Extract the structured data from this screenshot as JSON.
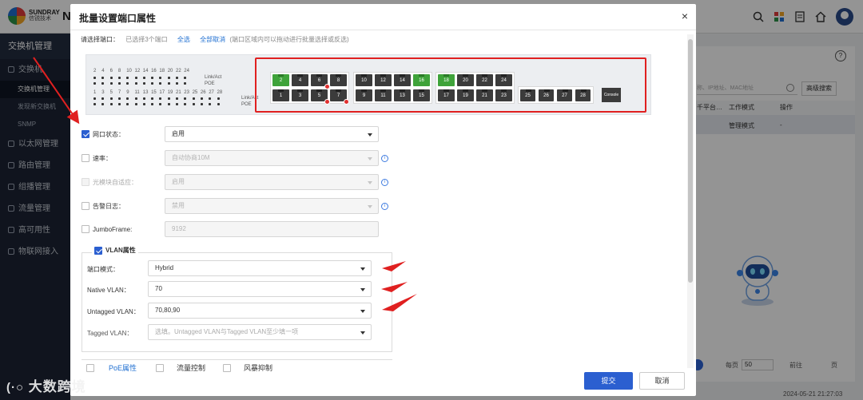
{
  "app": {
    "logo_line1": "SUNDRAY",
    "logo_line2": "信锐技术",
    "logo_suffix": "N",
    "sidebar_header": "交换机管理",
    "sidebar": [
      {
        "label": "交换机",
        "type": "item",
        "icon": "switch-icon"
      },
      {
        "label": "交换机管理",
        "type": "sub",
        "active": true
      },
      {
        "label": "发现新交换机",
        "type": "sub",
        "active": false
      },
      {
        "label": "SNMP",
        "type": "sub",
        "active": false
      },
      {
        "label": "以太网管理",
        "type": "item",
        "icon": "ethernet-icon"
      },
      {
        "label": "路由管理",
        "type": "item",
        "icon": "route-icon"
      },
      {
        "label": "组播管理",
        "type": "item",
        "icon": "multicast-icon"
      },
      {
        "label": "流量管理",
        "type": "item",
        "icon": "traffic-icon"
      },
      {
        "label": "高可用性",
        "type": "item",
        "icon": "ha-icon"
      },
      {
        "label": "物联网接入",
        "type": "item",
        "icon": "iot-icon"
      }
    ],
    "bg": {
      "search_placeholder": "称、IP地址、MAC地址",
      "advanced_search": "高级搜索",
      "col_platform": "千平台…",
      "col_mode": "工作模式",
      "col_ops": "操作",
      "row_mode": "管理模式",
      "row_ops": "-",
      "pager_label": "每页",
      "pager_size": "50",
      "pager_goto": "前往",
      "pager_page": "页",
      "timestamp": "2024-05-21 21:27:03"
    }
  },
  "dialog": {
    "title": "批量设置端口属性",
    "close": "×",
    "select_label": "请选择端口：",
    "select_count": "已选择3个端口",
    "select_all": "全选",
    "deselect_all": "全部取消",
    "select_hint": "(端口区域内可以拖动进行批量选择或反选)",
    "panel": {
      "top_numbers": [
        "2",
        "4",
        "6",
        "8",
        "10",
        "12",
        "14",
        "16",
        "18",
        "20",
        "22",
        "24"
      ],
      "bottom_numbers": [
        "1",
        "3",
        "5",
        "7",
        "9",
        "11",
        "13",
        "15",
        "17",
        "19",
        "21",
        "23",
        "25",
        "26",
        "27",
        "28"
      ],
      "label_link": "Link/Act",
      "label_poe": "POE",
      "groups": [
        {
          "top": [
            {
              "n": "2",
              "up": true
            },
            {
              "n": "4",
              "up": false
            },
            {
              "n": "6",
              "up": false,
              "err": true
            },
            {
              "n": "8",
              "up": false
            }
          ],
          "bottom": [
            {
              "n": "1",
              "up": false
            },
            {
              "n": "3",
              "up": false
            },
            {
              "n": "5",
              "up": false,
              "err": true
            },
            {
              "n": "7",
              "up": false,
              "err": true
            }
          ]
        },
        {
          "top": [
            {
              "n": "10",
              "up": false
            },
            {
              "n": "12",
              "up": false
            },
            {
              "n": "14",
              "up": false
            },
            {
              "n": "16",
              "up": true
            }
          ],
          "bottom": [
            {
              "n": "9",
              "up": false
            },
            {
              "n": "11",
              "up": false
            },
            {
              "n": "13",
              "up": false
            },
            {
              "n": "15",
              "up": false
            }
          ]
        },
        {
          "top": [
            {
              "n": "18",
              "up": true
            },
            {
              "n": "20",
              "up": false
            },
            {
              "n": "22",
              "up": false
            },
            {
              "n": "24",
              "up": false
            }
          ],
          "bottom": [
            {
              "n": "17",
              "up": false
            },
            {
              "n": "19",
              "up": false
            },
            {
              "n": "21",
              "up": false
            },
            {
              "n": "23",
              "up": false
            }
          ]
        }
      ],
      "sfp_ports": [
        "25",
        "26",
        "27",
        "28"
      ],
      "console_label": "Console"
    },
    "fields": {
      "port_status": {
        "label": "网口状态：",
        "checked": true,
        "value": "启用"
      },
      "speed": {
        "label": "速率：",
        "checked": false,
        "value": "自动协商10M"
      },
      "optical": {
        "label": "光模块自适应：",
        "checked": false,
        "value": "启用"
      },
      "alarm_log": {
        "label": "告警日志：",
        "checked": false,
        "value": "禁用"
      },
      "jumbo": {
        "label": "JumboFrame:",
        "checked": false,
        "value": "9192"
      }
    },
    "vlan": {
      "title": "VLAN属性",
      "checked": true,
      "port_mode_label": "端口模式：",
      "port_mode_value": "Hybrid",
      "native_label": "Native VLAN：",
      "native_value": "70",
      "untagged_label": "Untagged VLAN：",
      "untagged_value": "70,80,90",
      "tagged_label": "Tagged VLAN：",
      "tagged_placeholder": "选填。Untagged VLAN与Tagged VLAN至少填一项"
    },
    "bottom_tabs": [
      "PoE属性",
      "流量控制",
      "风暴抑制"
    ],
    "submit": "提交",
    "cancel": "取消"
  },
  "watermark": "大数跨境",
  "colors": {
    "accent": "#2b5fd0",
    "port_up": "#3fa33a",
    "port_down": "#3b3b3b",
    "annotation": "#e02020"
  }
}
